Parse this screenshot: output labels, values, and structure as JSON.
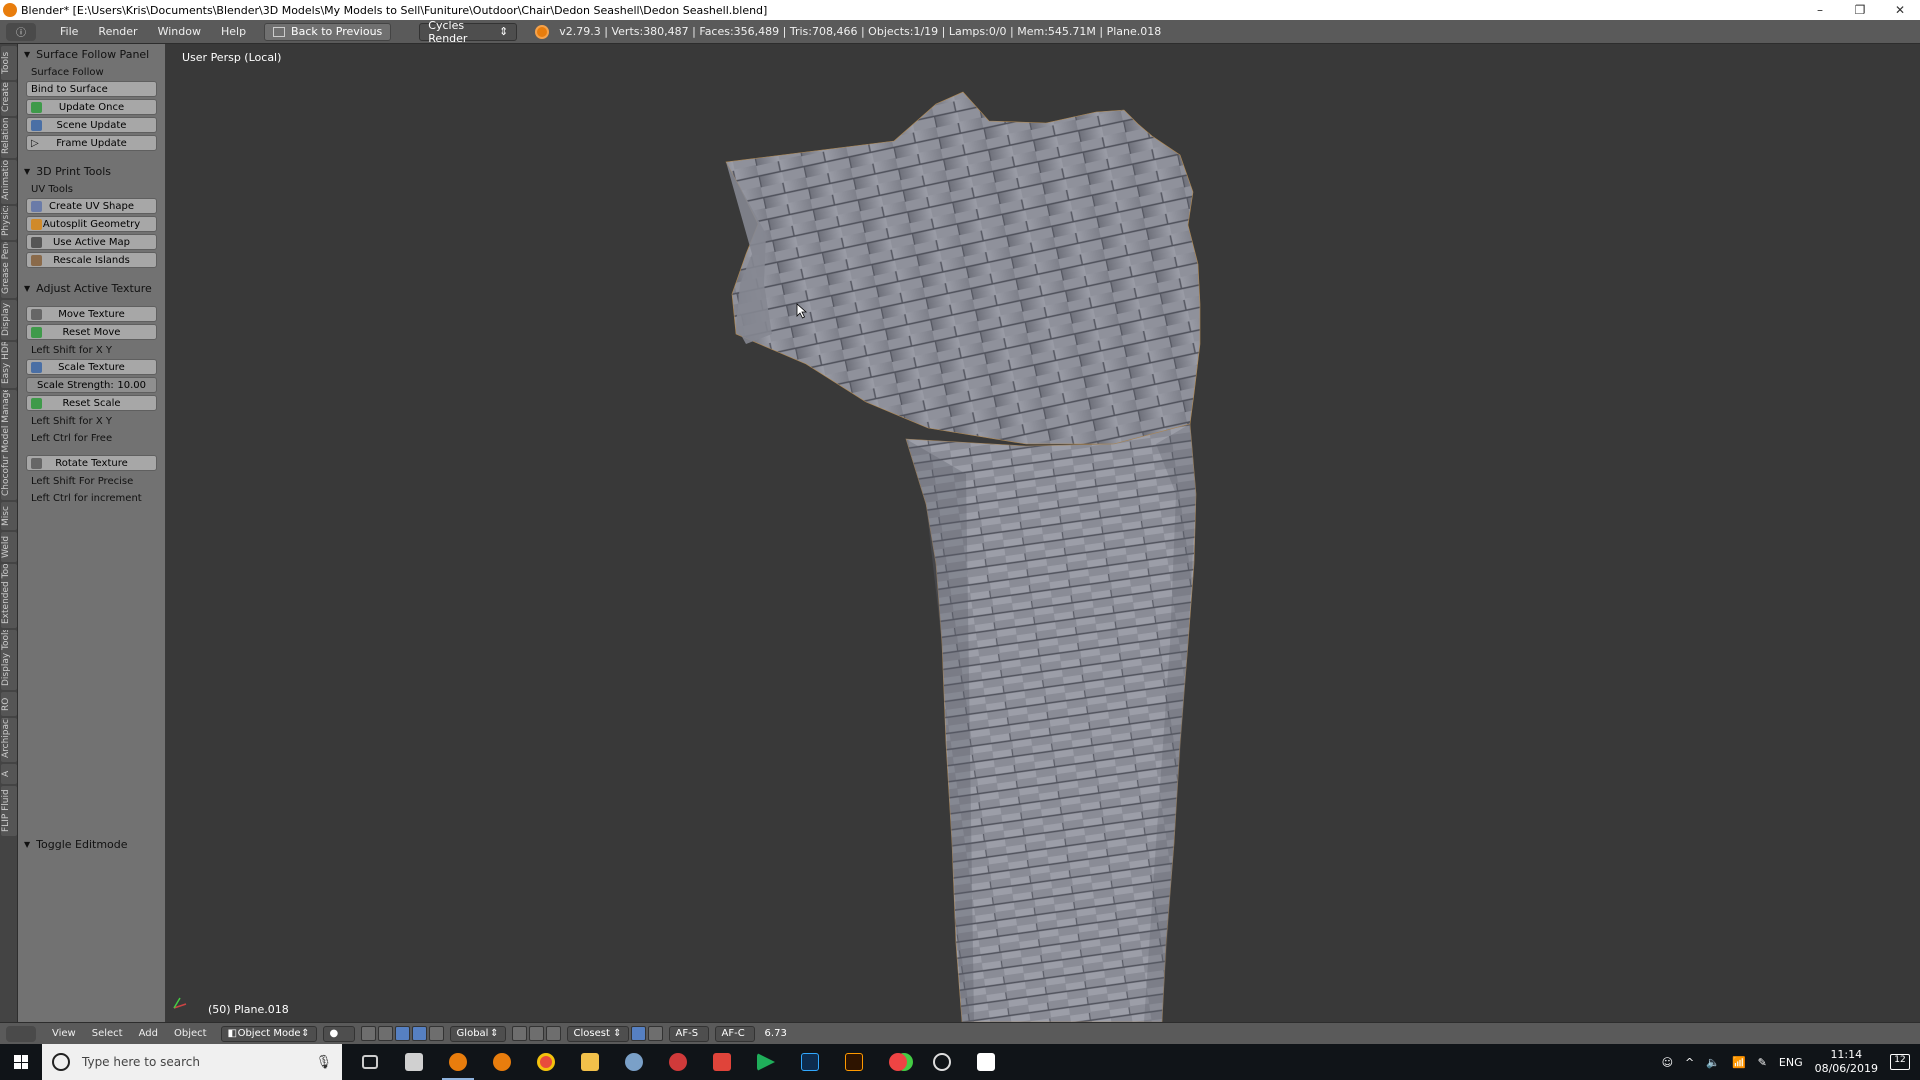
{
  "window": {
    "title": "Blender* [E:\\Users\\Kris\\Documents\\Blender\\3D Models\\My Models to Sell\\Funiture\\Outdoor\\Chair\\Dedon Seashell\\Dedon Seashell.blend]",
    "minimize": "–",
    "maximize": "❐",
    "close": "✕"
  },
  "infobar": {
    "menu": [
      "File",
      "Render",
      "Window",
      "Help"
    ],
    "back_label": "Back to Previous",
    "engine": "Cycles Render",
    "stats": "v2.79.3 | Verts:380,487 | Faces:356,489 | Tris:708,466 | Objects:1/19 | Lamps:0/0 | Mem:545.71M | Plane.018"
  },
  "tabs": [
    "Tools",
    "Create",
    "Relations",
    "Animation",
    "Physics",
    "Grease Pencil",
    "Display",
    "Easy HDRI",
    "Chocofur Model Manager",
    "Misc",
    "Weld",
    "Extended Tools",
    "Display Tools",
    "RO",
    "Archipack",
    "A",
    "FLIP Fluid"
  ],
  "toolshelf": {
    "surface_follow": {
      "header": "Surface Follow Panel",
      "label": "Surface Follow",
      "bind": "Bind to Surface",
      "update_once": "Update Once",
      "scene_update": "Scene Update",
      "frame_update": "Frame Update"
    },
    "print_tools": {
      "header": "3D Print Tools",
      "uv_label": "UV Tools",
      "create_uv": "Create UV Shape",
      "autosplit": "Autosplit Geometry",
      "use_active": "Use Active Map",
      "rescale": "Rescale Islands"
    },
    "adjust_texture": {
      "header": "Adjust Active Texture",
      "move": "Move Texture",
      "reset_move": "Reset Move",
      "hint_shift_xy": "Left Shift for X Y",
      "scale": "Scale Texture",
      "scale_strength_label": "Scale Strength:",
      "scale_strength_value": "10.00",
      "reset_scale": "Reset Scale",
      "hint_shift_xy2": "Left Shift for X Y",
      "hint_ctrl_free": "Left Ctrl for Free",
      "rotate": "Rotate Texture",
      "hint_shift_precise": "Left Shift For Precise",
      "hint_ctrl_increment": "Left Ctrl for increment"
    },
    "toggle_editmode": "Toggle Editmode"
  },
  "viewport": {
    "perspective": "User Persp (Local)",
    "object_label": "(50) Plane.018"
  },
  "view_header": {
    "menu": [
      "View",
      "Select",
      "Add",
      "Object"
    ],
    "mode": "Object Mode",
    "orientation": "Global",
    "snap": "Closest",
    "af_s": "AF-S",
    "af_c": "AF-C",
    "value": "6.73"
  },
  "taskbar": {
    "search_placeholder": "Type here to search",
    "lang": "ENG",
    "time": "11:14",
    "date": "08/06/2019",
    "notifications": "12"
  },
  "colors": {
    "blender_orange": "#e87d0d",
    "panel_grey": "#727272",
    "viewport_bg": "#393939",
    "mesh": "#8b8d97"
  }
}
